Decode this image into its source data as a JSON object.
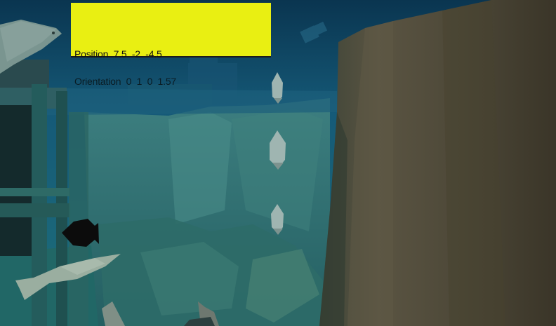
{
  "hud": {
    "position_text": "Position  7.5  -2  -4.5",
    "orientation_text": "Orientation  0  1  0  1.57",
    "panel_color": "#e9ef12"
  },
  "scene": {
    "description_colors": {
      "water_deep": "#0b3b52",
      "water_mid": "#1d5d73",
      "rock_wall": "#2f6a6a",
      "pillar": "#4f4a3c",
      "sand": "#246b6b"
    }
  }
}
